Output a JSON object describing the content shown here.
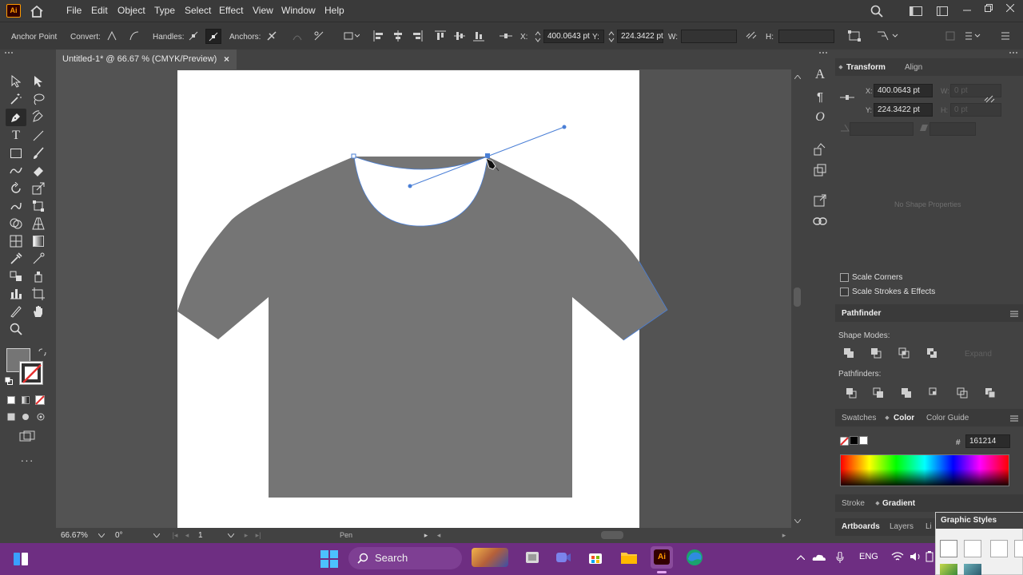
{
  "menubar": {
    "app_logo": "Ai",
    "items": [
      "File",
      "Edit",
      "Object",
      "Type",
      "Select",
      "Effect",
      "View",
      "Window",
      "Help"
    ]
  },
  "control_bar": {
    "anchor_point": "Anchor Point",
    "convert": "Convert:",
    "handles": "Handles:",
    "anchors": "Anchors:",
    "x_label": "X:",
    "x_value": "400.0643 pt",
    "y_label": "Y:",
    "y_value": "224.3422 pt",
    "w_label": "W:",
    "h_label": "H:"
  },
  "document_tab": {
    "title": "Untitled-1* @ 66.67 % (CMYK/Preview)",
    "close": "×"
  },
  "status_bar": {
    "zoom": "66.67%",
    "rotation": "0°",
    "artboard": "1",
    "tool": "Pen"
  },
  "transform_panel": {
    "tabs": [
      "Transform",
      "Align"
    ],
    "x_label": "X:",
    "x_value": "400.0643 pt",
    "y_label": "Y:",
    "y_value": "224.3422 pt",
    "w_label": "W:",
    "h_label": "H:",
    "w_value": "0 pt",
    "h_value": "0 pt",
    "no_shape": "No Shape Properties",
    "scale_corners": "Scale Corners",
    "scale_strokes": "Scale Strokes & Effects"
  },
  "pathfinder_panel": {
    "title": "Pathfinder",
    "shape_modes": "Shape Modes:",
    "expand": "Expand",
    "pathfinders": "Pathfinders:"
  },
  "color_panel": {
    "tabs": [
      "Swatches",
      "Color",
      "Color Guide"
    ],
    "hash": "#",
    "hex": "161214"
  },
  "stroke_panel": {
    "tabs": [
      "Stroke",
      "Gradient"
    ]
  },
  "bottom_tabs": {
    "tabs": [
      "Artboards",
      "Layers",
      "Li"
    ]
  },
  "graphic_styles": {
    "title": "Graphic Styles"
  },
  "taskbar": {
    "search": "Search",
    "lang": "ENG"
  },
  "colors": {
    "shirt_fill": "#757575",
    "path_blue": "#4a7fd6",
    "taskbar": "#6e2e82"
  }
}
